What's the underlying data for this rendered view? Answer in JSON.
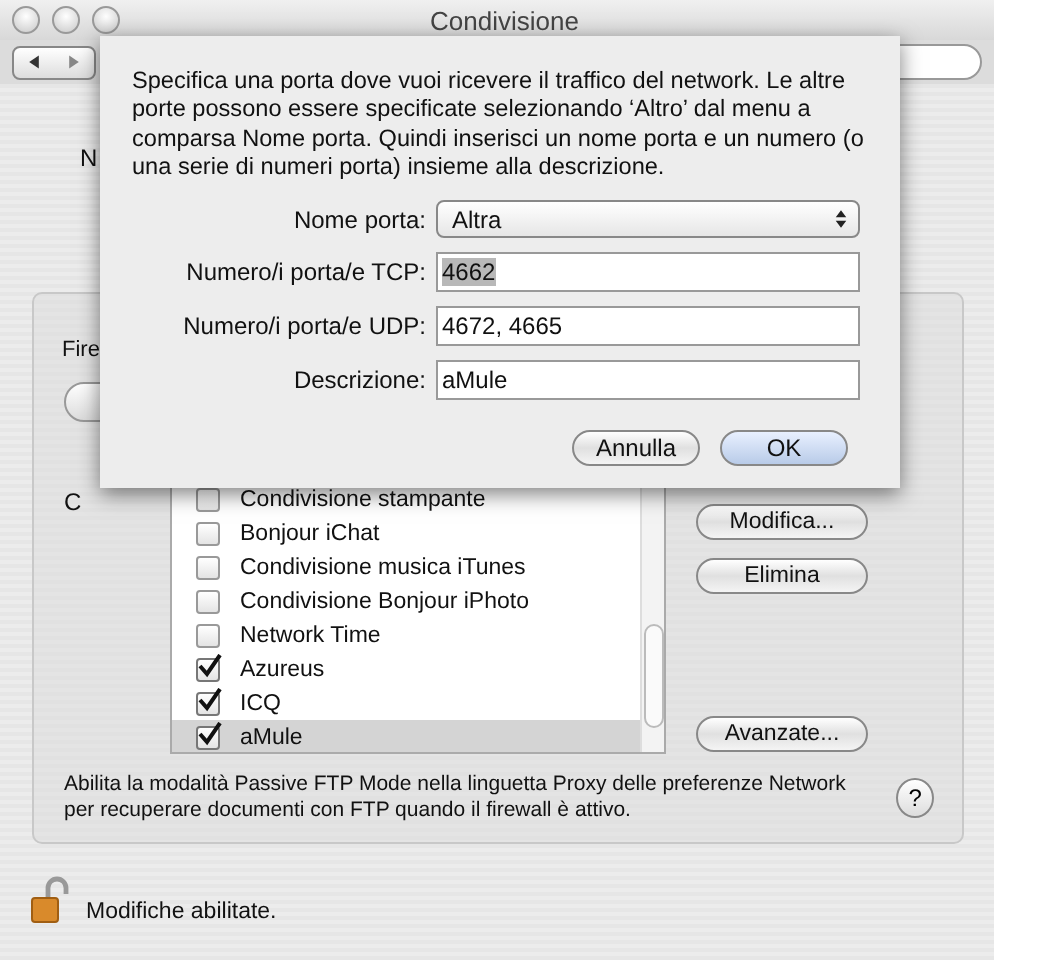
{
  "window": {
    "title": "Condivisione"
  },
  "background": {
    "computer_name_label": "N",
    "firewall_label": "Fire",
    "allow_label": "C"
  },
  "sheet": {
    "message": "Specifica una porta dove vuoi ricevere il traffico del network. Le altre porte possono essere specificate selezionando ‘Altro’ dal menu a comparsa Nome porta. Quindi inserisci un nome porta e un numero (o una serie di numeri porta) insieme alla descrizione.",
    "fields": [
      {
        "label": "Nome porta:",
        "kind": "popup",
        "value": "Altra"
      },
      {
        "label": "Numero/i porta/e TCP:",
        "kind": "text",
        "value": "4662",
        "highlighted": true
      },
      {
        "label": "Numero/i porta/e UDP:",
        "kind": "text",
        "value": "4672, 4665",
        "highlighted": false
      },
      {
        "label": "Descrizione:",
        "kind": "text",
        "value": "aMule",
        "highlighted": false
      }
    ],
    "buttons": [
      {
        "label": "Annulla",
        "default": false
      },
      {
        "label": "OK",
        "default": true
      }
    ]
  },
  "services": [
    {
      "name": "Condivisione stampante",
      "checked": false,
      "selected": false
    },
    {
      "name": "Bonjour iChat",
      "checked": false,
      "selected": false
    },
    {
      "name": "Condivisione musica iTunes",
      "checked": false,
      "selected": false
    },
    {
      "name": "Condivisione Bonjour iPhoto",
      "checked": false,
      "selected": false
    },
    {
      "name": "Network Time",
      "checked": false,
      "selected": false
    },
    {
      "name": "Azureus",
      "checked": true,
      "selected": false
    },
    {
      "name": "ICQ",
      "checked": true,
      "selected": false
    },
    {
      "name": "aMule",
      "checked": true,
      "selected": true
    }
  ],
  "side_buttons": [
    {
      "label": "Modifica...",
      "kind": "top"
    },
    {
      "label": "Elimina",
      "kind": "top"
    },
    {
      "label": "Avanzate...",
      "kind": "bottom"
    }
  ],
  "note": "Abilita la modalità Passive FTP Mode nella linguetta Proxy delle preferenze Network per recuperare documenti con FTP quando il firewall è attivo.",
  "help": "?",
  "lock": {
    "locked": false,
    "label": "Modifiche abilitate."
  }
}
